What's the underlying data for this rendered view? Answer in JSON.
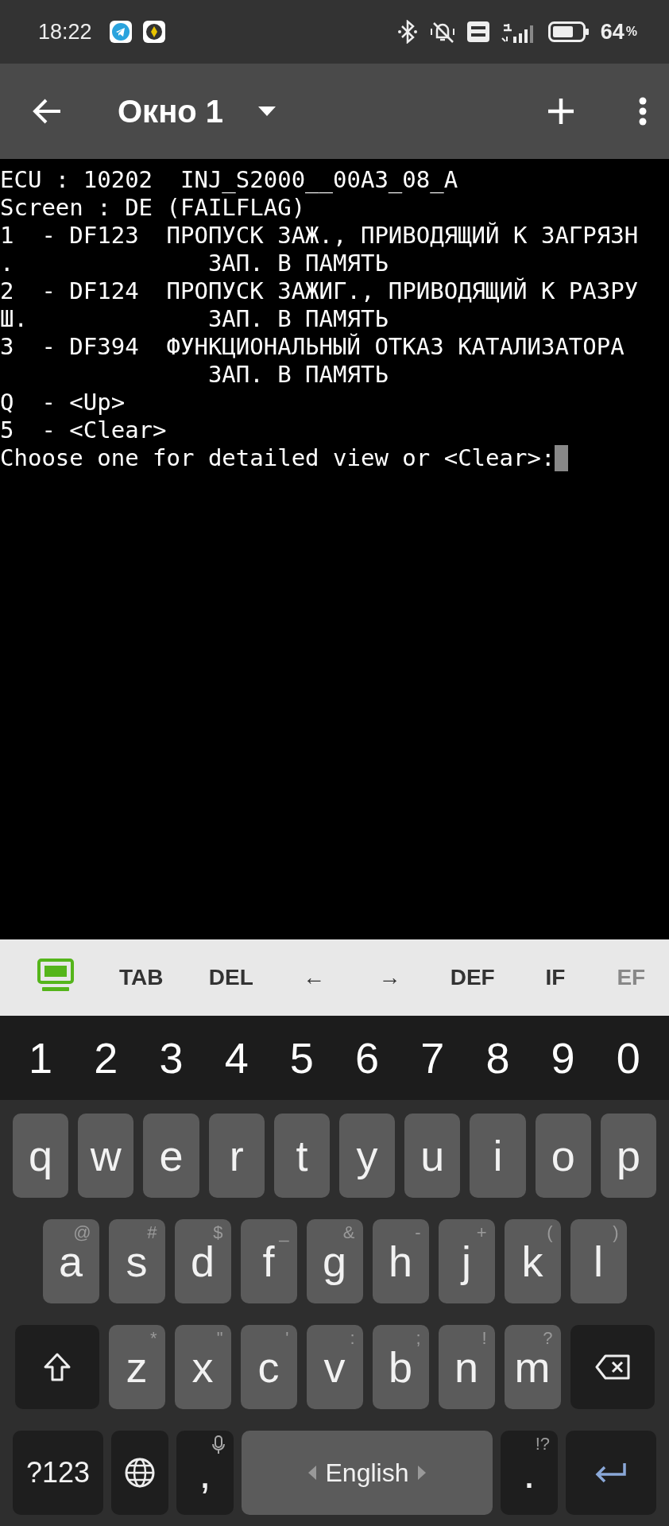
{
  "status_bar": {
    "time": "18:22",
    "battery": "64",
    "battery_unit": "%"
  },
  "app_bar": {
    "title": "Окно 1"
  },
  "terminal": {
    "lines": [
      "ECU : 10202  INJ_S2000__00A3_08_A",
      "Screen : DE (FAILFLAG)",
      "1  - DF123  ПРОПУСК ЗАЖ., ПРИВОДЯЩИЙ К ЗАГРЯЗН",
      ".              ЗАП. В ПАМЯТЬ",
      "2  - DF124  ПРОПУСК ЗАЖИГ., ПРИВОДЯЩИЙ К РАЗРУ",
      "Ш.             ЗАП. В ПАМЯТЬ",
      "3  - DF394  ФУНКЦИОНАЛЬНЫЙ ОТКАЗ КАТАЛИЗАТОРА",
      "               ЗАП. В ПАМЯТЬ",
      "Q  - <Up>",
      "5  - <Clear>",
      "Choose one for detailed view or <Clear>:"
    ]
  },
  "extra_keys": [
    {
      "kind": "icon"
    },
    {
      "kind": "text",
      "label": "TAB"
    },
    {
      "kind": "text",
      "label": "DEL"
    },
    {
      "kind": "text",
      "label": "←"
    },
    {
      "kind": "text",
      "label": "→"
    },
    {
      "kind": "text",
      "label": "DEF"
    },
    {
      "kind": "text",
      "label": "IF"
    },
    {
      "kind": "text",
      "label": "EF",
      "faded": true
    }
  ],
  "number_row": [
    "1",
    "2",
    "3",
    "4",
    "5",
    "6",
    "7",
    "8",
    "9",
    "0"
  ],
  "keyboard_rows": [
    [
      {
        "kind": "letter",
        "label": "q"
      },
      {
        "kind": "letter",
        "label": "w"
      },
      {
        "kind": "letter",
        "label": "e"
      },
      {
        "kind": "letter",
        "label": "r"
      },
      {
        "kind": "letter",
        "label": "t"
      },
      {
        "kind": "letter",
        "label": "y"
      },
      {
        "kind": "letter",
        "label": "u"
      },
      {
        "kind": "letter",
        "label": "i"
      },
      {
        "kind": "letter",
        "label": "o"
      },
      {
        "kind": "letter",
        "label": "p"
      }
    ],
    [
      {
        "kind": "letter",
        "label": "a",
        "hint": "@"
      },
      {
        "kind": "letter",
        "label": "s",
        "hint": "#"
      },
      {
        "kind": "letter",
        "label": "d",
        "hint": "$"
      },
      {
        "kind": "letter",
        "label": "f",
        "hint": "_"
      },
      {
        "kind": "letter",
        "label": "g",
        "hint": "&"
      },
      {
        "kind": "letter",
        "label": "h",
        "hint": "-"
      },
      {
        "kind": "letter",
        "label": "j",
        "hint": "+"
      },
      {
        "kind": "letter",
        "label": "k",
        "hint": "("
      },
      {
        "kind": "letter",
        "label": "l",
        "hint": ")"
      }
    ],
    [
      {
        "kind": "shift"
      },
      {
        "kind": "letter",
        "label": "z",
        "hint": "*"
      },
      {
        "kind": "letter",
        "label": "x",
        "hint": "\""
      },
      {
        "kind": "letter",
        "label": "c",
        "hint": "'"
      },
      {
        "kind": "letter",
        "label": "v",
        "hint": ":"
      },
      {
        "kind": "letter",
        "label": "b",
        "hint": ";"
      },
      {
        "kind": "letter",
        "label": "n",
        "hint": "!"
      },
      {
        "kind": "letter",
        "label": "m",
        "hint": "?"
      },
      {
        "kind": "backspace"
      }
    ],
    [
      {
        "kind": "symbols",
        "label": "?123"
      },
      {
        "kind": "globe"
      },
      {
        "kind": "comma",
        "label": ","
      },
      {
        "kind": "space",
        "label": "English"
      },
      {
        "kind": "period",
        "label": ".",
        "hint": "!?"
      },
      {
        "kind": "enter"
      }
    ]
  ]
}
